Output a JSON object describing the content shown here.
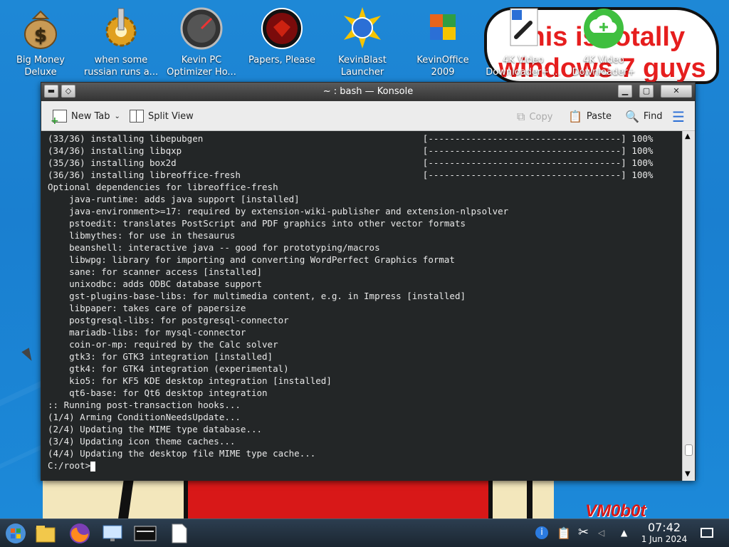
{
  "desktop": {
    "icons": [
      {
        "label1": "Big Money",
        "label2": "Deluxe",
        "icon": "money-bag-icon"
      },
      {
        "label1": "when some",
        "label2": "russian runs a...",
        "icon": "gear-icon"
      },
      {
        "label1": "Kevin PC",
        "label2": "Optimizer Ho...",
        "icon": "speedometer-icon"
      },
      {
        "label1": "Papers, Please",
        "label2": "",
        "icon": "arstotzka-seal-icon"
      },
      {
        "label1": "KevinBlast",
        "label2": "Launcher",
        "icon": "globe-sun-icon"
      },
      {
        "label1": "KevinOffice",
        "label2": "2009",
        "icon": "office-icon"
      },
      {
        "label1": "4K Video",
        "label2": "Downloader+ ...",
        "icon": "link-file-icon"
      },
      {
        "label1": "4K Video",
        "label2": "Downloader+",
        "icon": "cloud-download-icon"
      }
    ],
    "scribble_text": "this is totally windows 7 guys",
    "watermark": "VM0b0t"
  },
  "window": {
    "title": "~ : bash — Konsole",
    "toolbar": {
      "new_tab": "New Tab",
      "split_view": "Split View",
      "copy": "Copy",
      "paste": "Paste",
      "find": "Find"
    },
    "terminal_lines": [
      "(33/36) installing libepubgen                                         [------------------------------------] 100%",
      "(34/36) installing libqxp                                             [------------------------------------] 100%",
      "(35/36) installing box2d                                              [------------------------------------] 100%",
      "(36/36) installing libreoffice-fresh                                  [------------------------------------] 100%",
      "Optional dependencies for libreoffice-fresh",
      "    java-runtime: adds java support [installed]",
      "    java-environment>=17: required by extension-wiki-publisher and extension-nlpsolver",
      "    pstoedit: translates PostScript and PDF graphics into other vector formats",
      "    libmythes: for use in thesaurus",
      "    beanshell: interactive java -- good for prototyping/macros",
      "    libwpg: library for importing and converting WordPerfect Graphics format",
      "    sane: for scanner access [installed]",
      "    unixodbc: adds ODBC database support",
      "    gst-plugins-base-libs: for multimedia content, e.g. in Impress [installed]",
      "    libpaper: takes care of papersize",
      "    postgresql-libs: for postgresql-connector",
      "    mariadb-libs: for mysql-connector",
      "    coin-or-mp: required by the Calc solver",
      "    gtk3: for GTK3 integration [installed]",
      "    gtk4: for GTK4 integration (experimental)",
      "    kio5: for KF5 KDE desktop integration [installed]",
      "    qt6-base: for Qt6 desktop integration",
      ":: Running post-transaction hooks...",
      "(1/4) Arming ConditionNeedsUpdate...",
      "(2/4) Updating the MIME type database...",
      "(3/4) Updating icon theme caches...",
      "(4/4) Updating the desktop file MIME type cache..."
    ],
    "prompt": "C:/root>"
  },
  "taskbar": {
    "time": "07:42",
    "date": "1 Jun 2024"
  }
}
